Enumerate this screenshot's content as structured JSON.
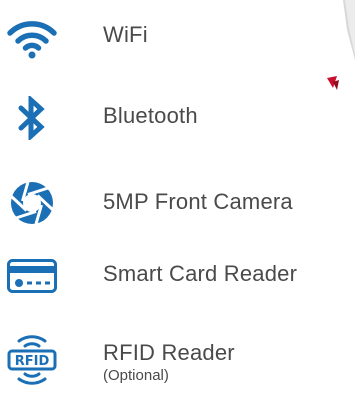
{
  "colors": {
    "icon_blue": "#1b6fb5",
    "text_gray": "#4a4a4a",
    "accent_red": "#c8102e"
  },
  "features": [
    {
      "icon": "wifi-icon",
      "label": "WiFi"
    },
    {
      "icon": "bluetooth-icon",
      "label": "Bluetooth"
    },
    {
      "icon": "camera-aperture-icon",
      "label": "5MP Front Camera"
    },
    {
      "icon": "smart-card-icon",
      "label": "Smart Card Reader"
    },
    {
      "icon": "rfid-icon",
      "label": "RFID Reader",
      "note": "(Optional)"
    }
  ]
}
